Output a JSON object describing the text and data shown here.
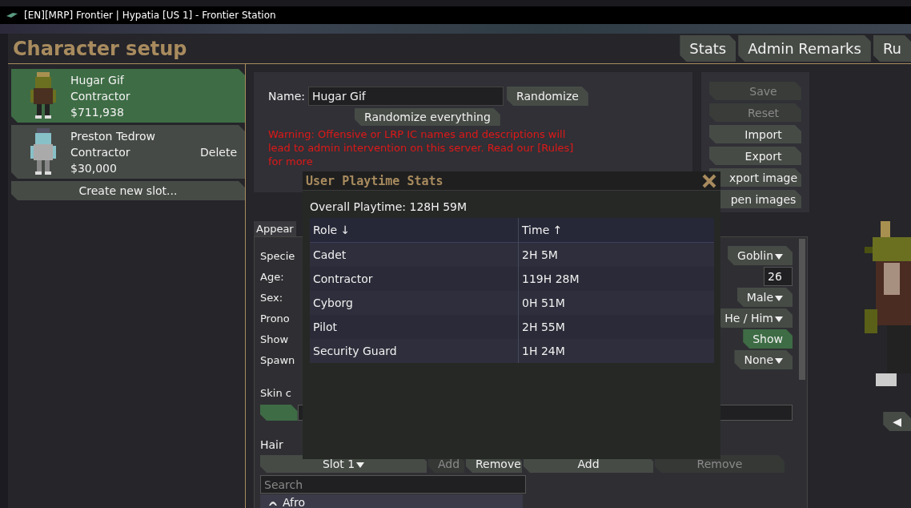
{
  "window": {
    "title": "[EN][MRP] Frontier | Hypatia [US 1] - Frontier Station"
  },
  "header": {
    "title": "Character setup",
    "tabs": [
      {
        "label": "Stats"
      },
      {
        "label": "Admin Remarks"
      },
      {
        "label": "Ru"
      }
    ]
  },
  "slots": [
    {
      "name": "Hugar Gif",
      "job": "Contractor",
      "money": "$711,938",
      "selected": true
    },
    {
      "name": "Preston Tedrow",
      "job": "Contractor",
      "money": "$30,000",
      "selected": false,
      "delete_label": "Delete"
    }
  ],
  "create_slot": "Create new slot...",
  "name_panel": {
    "label": "Name:",
    "value": "Hugar Gif",
    "randomize": "Randomize",
    "randomize_all": "Randomize everything",
    "warning": "Warning: Offensive or LRP IC names and descriptions will lead to admin intervention on this server. Read our [Rules] for more"
  },
  "actions": [
    {
      "label": "Save",
      "disabled": true
    },
    {
      "label": "Reset",
      "disabled": true
    },
    {
      "label": "Import",
      "disabled": false
    },
    {
      "label": "Export",
      "disabled": false
    },
    {
      "label": "xport image",
      "disabled": false
    },
    {
      "label": "pen images",
      "disabled": false
    }
  ],
  "appearance": {
    "tab": "Appear",
    "rows": [
      {
        "label": "Specie",
        "kind": "dropdown",
        "value": "Goblin"
      },
      {
        "label": "Age:",
        "kind": "number",
        "value": "26"
      },
      {
        "label": "Sex:",
        "kind": "dropdown",
        "value": "Male"
      },
      {
        "label": "Prono",
        "kind": "dropdown",
        "value": "He / Him"
      },
      {
        "label": "Show",
        "kind": "toggle",
        "value": "Show",
        "on": true
      },
      {
        "label": "Spawn",
        "kind": "dropdown",
        "value": "None"
      }
    ],
    "skin": {
      "label": "Skin c",
      "level": 0.07
    },
    "hair": {
      "label": "Hair",
      "slot": "Slot 1",
      "buttons": [
        {
          "label": "Add",
          "disabled": true
        },
        {
          "label": "Remove",
          "disabled": false
        },
        {
          "label": "Add",
          "disabled": false
        },
        {
          "label": "Remove",
          "disabled": true
        }
      ],
      "search_placeholder": "Search",
      "items": [
        {
          "label": "Afro"
        }
      ]
    }
  },
  "rotate_button": "◀",
  "modal": {
    "title": "User Playtime Stats",
    "overall": "Overall Playtime: 128H 59M",
    "columns": [
      "Role ↓",
      "Time ↑"
    ],
    "rows": [
      [
        "Cadet",
        "2H 5M"
      ],
      [
        "Contractor",
        "119H 28M"
      ],
      [
        "Cyborg",
        "0H 51M"
      ],
      [
        "Pilot",
        "2H 55M"
      ],
      [
        "Security Guard",
        "1H 24M"
      ]
    ]
  }
}
